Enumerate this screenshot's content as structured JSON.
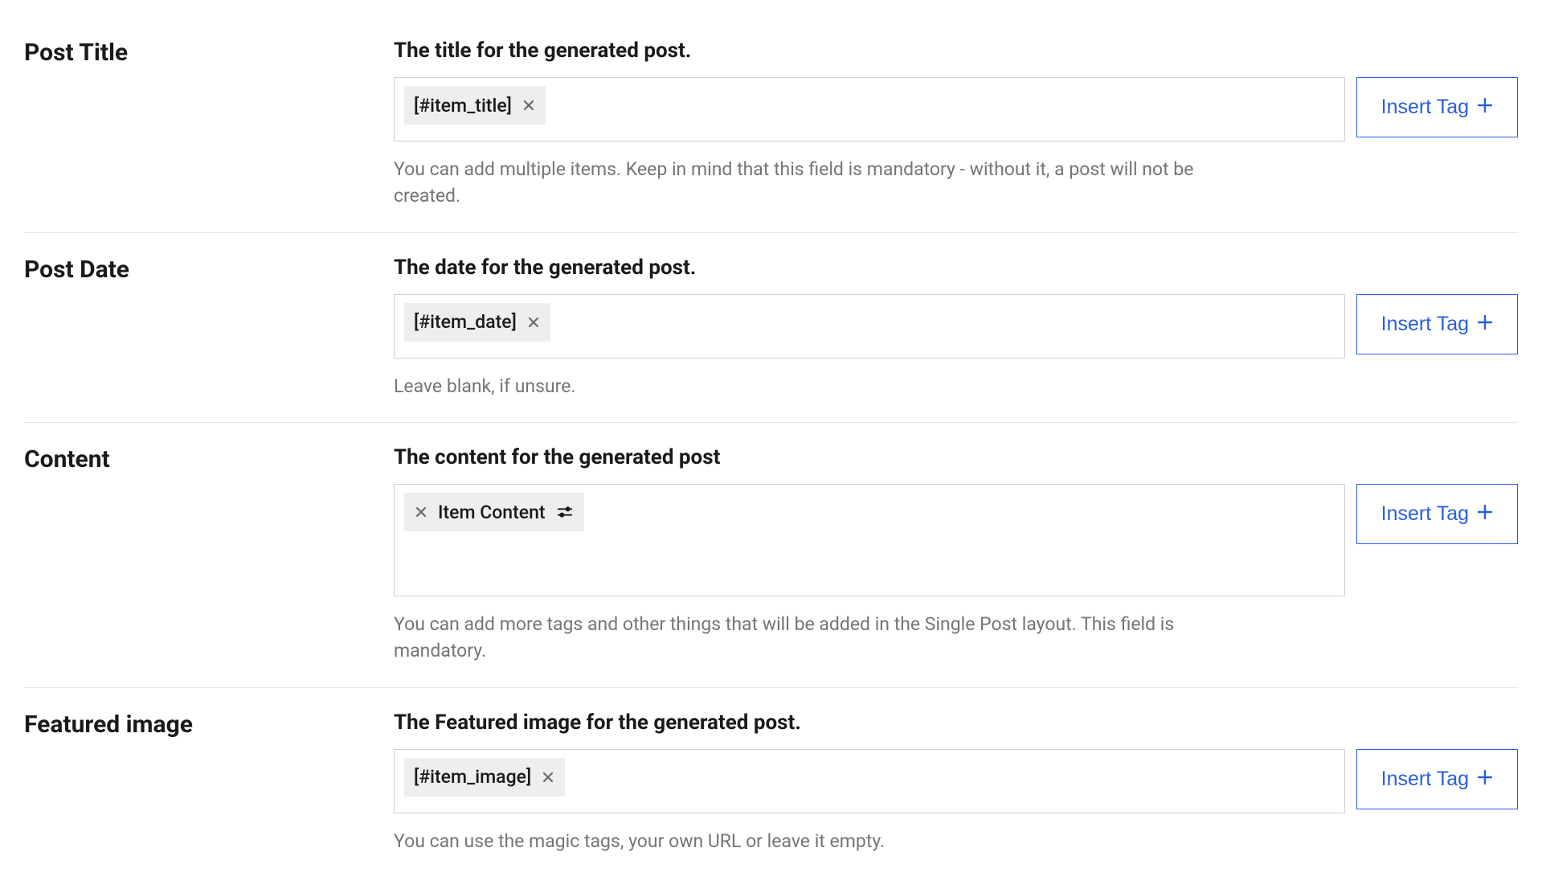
{
  "insertTagLabel": "Insert Tag",
  "rows": [
    {
      "label": "Post Title",
      "heading": "The title for the generated post.",
      "chip": {
        "type": "code",
        "text": "[#item_title]"
      },
      "help": "You can add multiple items. Keep in mind that this field is mandatory - without it, a post will not be created.",
      "tall": false
    },
    {
      "label": "Post Date",
      "heading": "The date for the generated post.",
      "chip": {
        "type": "code",
        "text": "[#item_date]"
      },
      "help": "Leave blank, if unsure.",
      "tall": false
    },
    {
      "label": "Content",
      "heading": "The content for the generated post",
      "chip": {
        "type": "labelled",
        "text": "Item Content"
      },
      "help": "You can add more tags and other things that will be added in the Single Post layout. This field is mandatory.",
      "tall": true
    },
    {
      "label": "Featured image",
      "heading": "The Featured image for the generated post.",
      "chip": {
        "type": "code",
        "text": "[#item_image]"
      },
      "help": "You can use the magic tags, your own URL or leave it empty.",
      "tall": false
    }
  ]
}
